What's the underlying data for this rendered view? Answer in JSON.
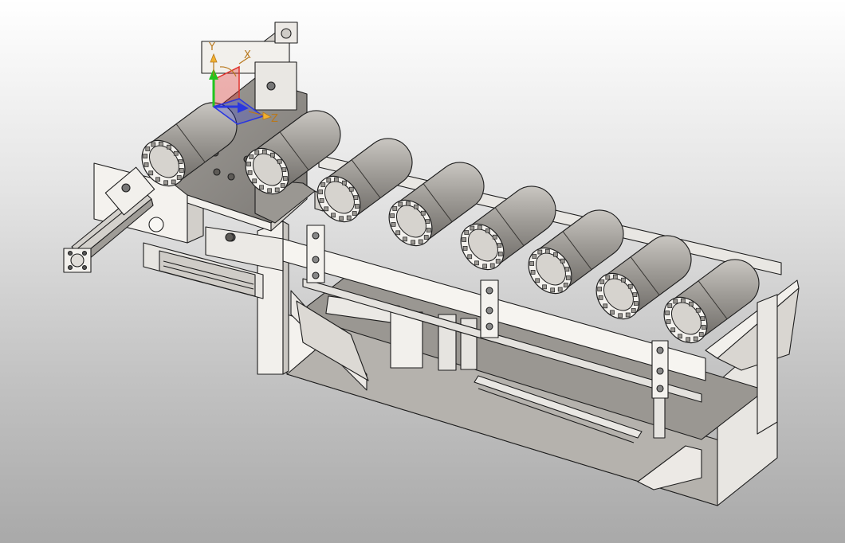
{
  "viewport": {
    "background_top": "#ffffff",
    "background_bottom": "#a9a9a9"
  },
  "triad": {
    "x_label": "X",
    "y_label": "Y",
    "z_label": "Z",
    "x_color": "#e0302a",
    "y_color": "#22c51e",
    "z_color": "#2a37e0",
    "label_color": "#b8781c"
  },
  "model": {
    "body_color": "#f4f2ee",
    "shade_color": "#8f8c88",
    "edge_color": "#1e1e1e",
    "roller_count": 8
  }
}
